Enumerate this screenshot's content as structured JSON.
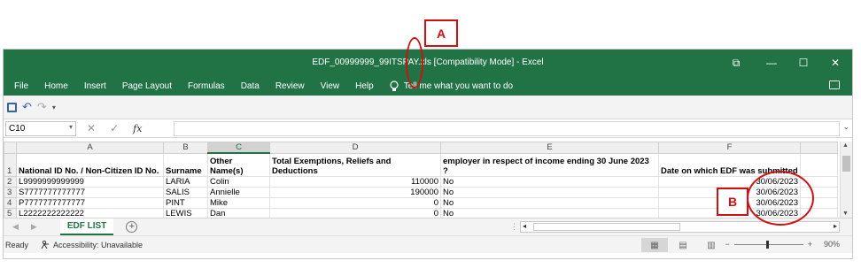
{
  "annotations": {
    "a": "A",
    "b": "B"
  },
  "window": {
    "title": "EDF_00999999_99ITSPAY.xls  [Compatibility Mode]  -  Excel",
    "controls": {
      "ribbon_display": "⧉",
      "minimize": "—",
      "maximize": "☐",
      "close": "✕"
    }
  },
  "ribbon_tabs": [
    "File",
    "Home",
    "Insert",
    "Page Layout",
    "Formulas",
    "Data",
    "Review",
    "View",
    "Help"
  ],
  "tell_me": "Tell me what you want to do",
  "quick_access": {
    "undo": "↶",
    "redo": "↷",
    "more": "▾"
  },
  "formula_bar": {
    "name_box": "C10",
    "cancel": "✕",
    "enter": "✓",
    "fx": "fx",
    "value": ""
  },
  "columns": [
    "A",
    "B",
    "C",
    "D",
    "E",
    "F"
  ],
  "selected_column": "C",
  "rows": [
    {
      "n": "1",
      "cells": [
        "National ID No. / Non-Citizen ID No.",
        "Surname",
        "Other Name(s)",
        "Total Exemptions, Reliefs and Deductions",
        "employer in respect of income ending 30 June 2023 ?",
        "Date on which EDF was submitted"
      ]
    },
    {
      "n": "2",
      "cells": [
        "L9999999999999",
        "LARIA",
        "Colin",
        "110000",
        "No",
        "30/06/2023"
      ]
    },
    {
      "n": "3",
      "cells": [
        "S7777777777777",
        "SALIS",
        "Annielle",
        "190000",
        "No",
        "30/06/2023"
      ]
    },
    {
      "n": "4",
      "cells": [
        "P7777777777777",
        "PINT",
        "Mike",
        "0",
        "No",
        "30/06/2023"
      ]
    },
    {
      "n": "5",
      "cells": [
        "L2222222222222",
        "LEWIS",
        "Dan",
        "0",
        "No",
        "30/06/2023"
      ]
    }
  ],
  "sheet_tabs": [
    "EDF LIST"
  ],
  "add_sheet": "+",
  "status": {
    "ready": "Ready",
    "accessibility": "Accessibility: Unavailable",
    "zoom_minus": "−",
    "zoom_plus": "+",
    "zoom_level": "90%"
  }
}
